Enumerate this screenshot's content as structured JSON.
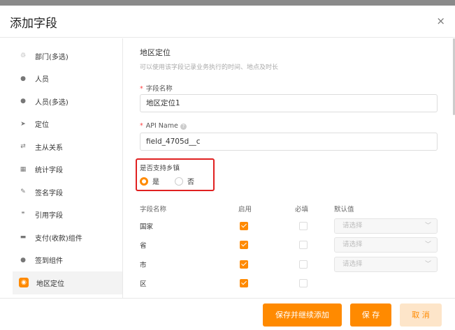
{
  "dialog": {
    "title": "添加字段",
    "close": "×"
  },
  "sidebar": {
    "items": [
      {
        "label": "部门(多选)",
        "icon": "recycle-icon",
        "glyph": "♲"
      },
      {
        "label": "人员",
        "icon": "person-icon",
        "glyph": "●"
      },
      {
        "label": "人员(多选)",
        "icon": "person-icon",
        "glyph": "●"
      },
      {
        "label": "定位",
        "icon": "location-arrow-icon",
        "glyph": "➤"
      },
      {
        "label": "主从关系",
        "icon": "link-icon",
        "glyph": "⇄"
      },
      {
        "label": "统计字段",
        "icon": "chart-icon",
        "glyph": "▦"
      },
      {
        "label": "签名字段",
        "icon": "signature-icon",
        "glyph": "✎"
      },
      {
        "label": "引用字段",
        "icon": "quote-icon",
        "glyph": "❞"
      },
      {
        "label": "支付(收款)组件",
        "icon": "payment-icon",
        "glyph": "▬"
      },
      {
        "label": "签到组件",
        "icon": "checkin-icon",
        "glyph": "●"
      },
      {
        "label": "地区定位",
        "icon": "map-pin-icon",
        "glyph": "◉",
        "active": true
      }
    ]
  },
  "main": {
    "section_title": "地区定位",
    "section_desc": "可以使用该字段记录业务执行的时间、地点及时长",
    "field_name_label": "字段名称",
    "field_name_value": "地区定位1",
    "api_name_label": "API Name",
    "api_name_value": "field_4705d__c",
    "support_town_label": "是否支持乡镇",
    "option_yes": "是",
    "option_no": "否",
    "table": {
      "col_field": "字段名称",
      "col_enable": "启用",
      "col_required": "必填",
      "col_default": "默认值",
      "rows": [
        {
          "label": "国家",
          "enabled": true,
          "required": false,
          "default": "请选择",
          "has_select": true
        },
        {
          "label": "省",
          "enabled": true,
          "required": false,
          "default": "请选择",
          "has_select": true
        },
        {
          "label": "市",
          "enabled": true,
          "required": false,
          "default": "请选择",
          "has_select": true
        },
        {
          "label": "区",
          "enabled": true,
          "required": false,
          "default": "",
          "has_select": false
        }
      ]
    }
  },
  "footer": {
    "save_continue": "保存并继续添加",
    "save": "保 存",
    "cancel": "取 消"
  },
  "colors": {
    "accent": "#ff8a00",
    "highlight_box": "#e02020"
  }
}
